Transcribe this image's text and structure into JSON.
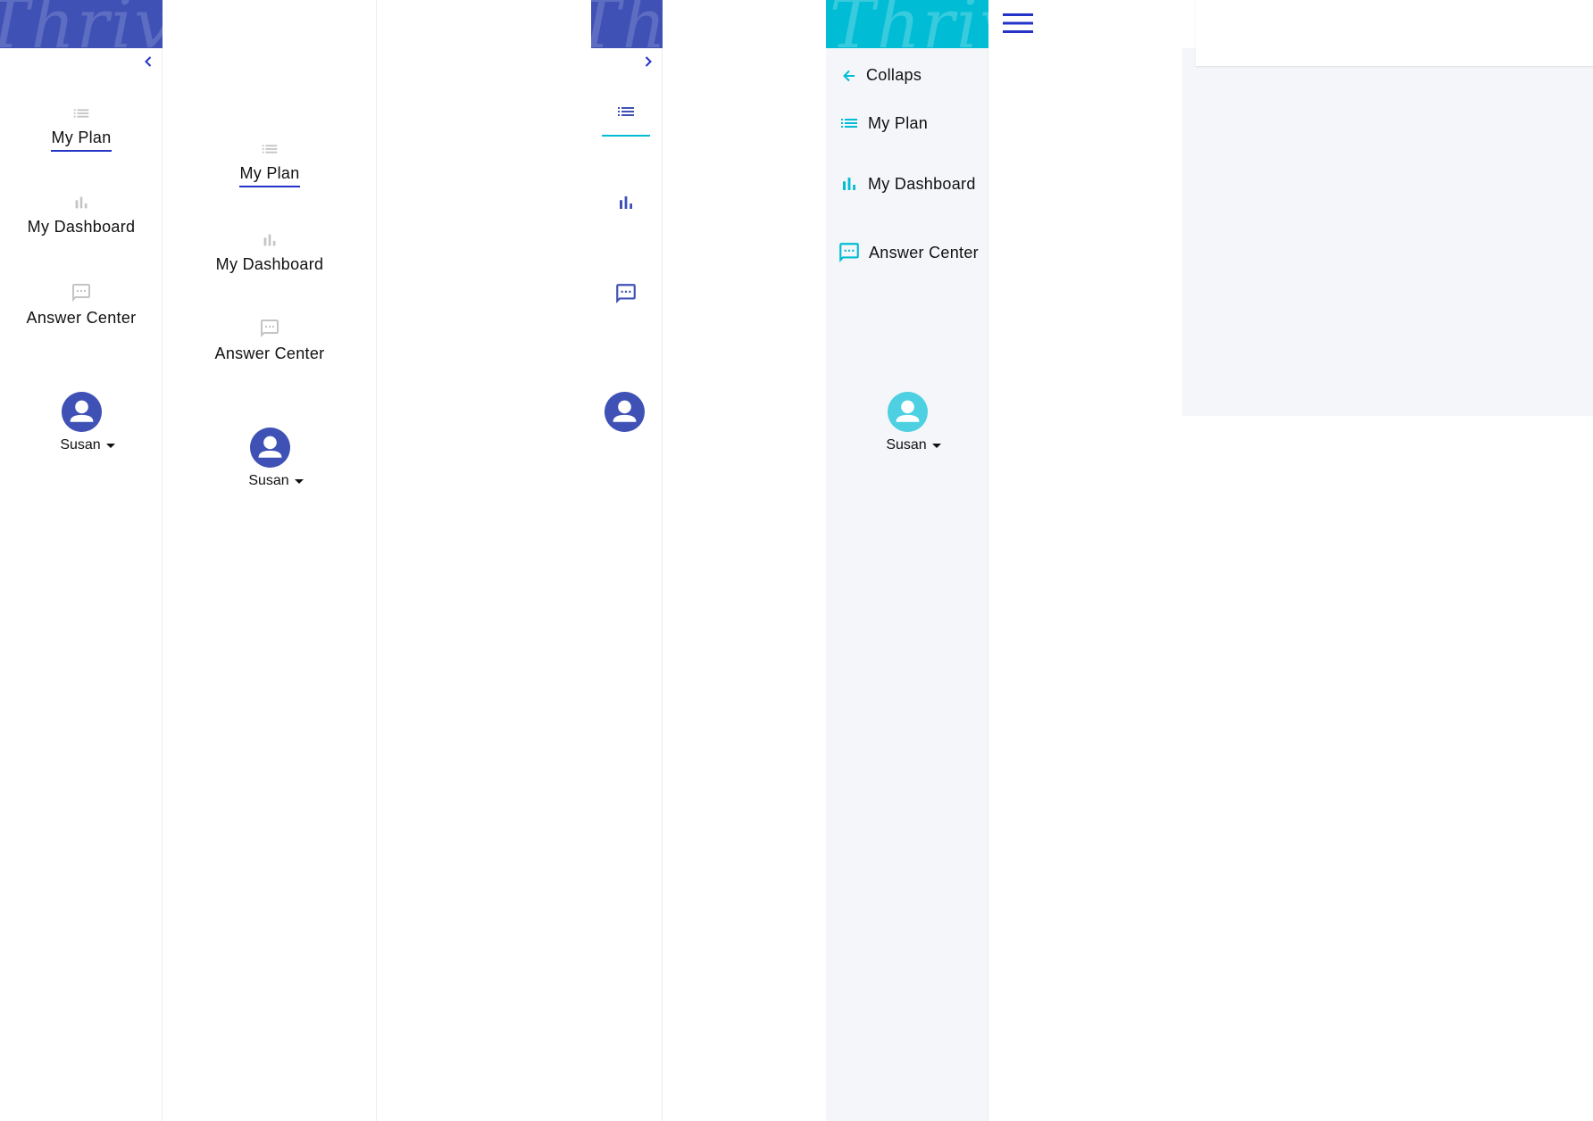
{
  "colors": {
    "brand_blue": "#3f51b5",
    "brand_cyan": "#00bcd4",
    "accent_link": "#2433c8",
    "icon_gray": "#c4c4c4",
    "panel_light": "#f5f6fa"
  },
  "brand": {
    "text": "Thrive"
  },
  "panel_a": {
    "collapse_icon": "chevron-left-icon",
    "nav": [
      {
        "label": "My Plan",
        "icon": "list-icon",
        "active": true
      },
      {
        "label": "My Dashboard",
        "icon": "bar-chart-icon"
      },
      {
        "label": "Answer Center",
        "icon": "chat-icon"
      }
    ],
    "user": {
      "name": "Susan"
    }
  },
  "panel_b": {
    "nav": [
      {
        "label": "My Plan",
        "icon": "list-icon",
        "active": true
      },
      {
        "label": "My Dashboard",
        "icon": "bar-chart-icon"
      },
      {
        "label": "Answer Center",
        "icon": "chat-icon"
      }
    ],
    "user": {
      "name": "Susan"
    }
  },
  "panel_c": {
    "expand_icon": "chevron-right-icon",
    "nav_icons": [
      "list-icon",
      "bar-chart-icon",
      "chat-icon"
    ],
    "user_icon": "avatar-icon"
  },
  "panel_d": {
    "collapse": {
      "label": "Collaps",
      "icon": "arrow-left-icon"
    },
    "nav": [
      {
        "label": "My Plan",
        "icon": "list-icon"
      },
      {
        "label": "My Dashboard",
        "icon": "bar-chart-icon"
      },
      {
        "label": "Answer Center",
        "icon": "chat-icon"
      }
    ],
    "user": {
      "name": "Susan"
    }
  },
  "header": {
    "menu_icon": "hamburger-menu-icon"
  }
}
